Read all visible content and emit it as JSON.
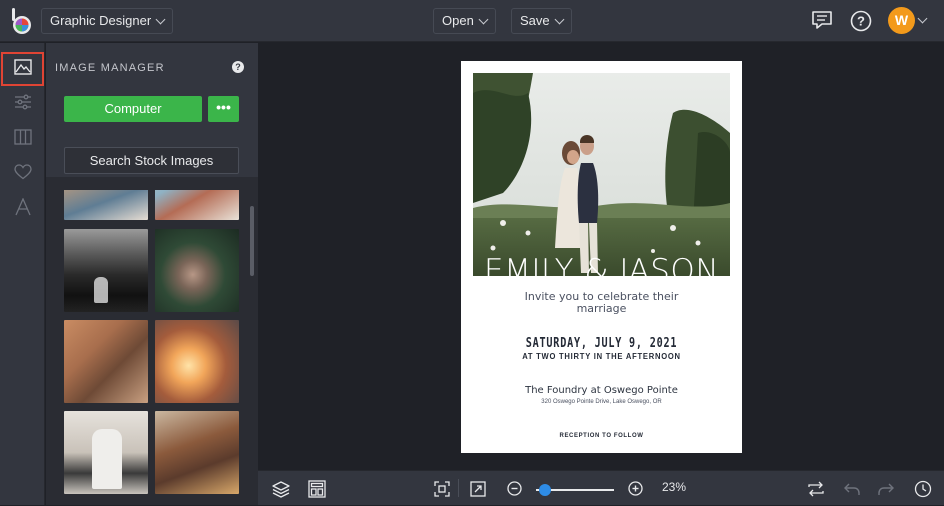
{
  "topbar": {
    "app_mode": "Graphic Designer",
    "open_label": "Open",
    "save_label": "Save",
    "avatar_initial": "W"
  },
  "sidebar": {
    "tools": [
      "image-manager",
      "adjust",
      "layout",
      "favorites",
      "text"
    ]
  },
  "panel": {
    "title": "IMAGE MANAGER",
    "computer_button": "Computer",
    "more_button": "•••",
    "search_stock_button": "Search Stock Images"
  },
  "invitation": {
    "names": "EMILY & JASON",
    "invite_line1": "Invite you to celebrate their",
    "invite_line2": "marriage",
    "date": "SATURDAY, JULY 9, 2021",
    "time": "AT TWO THIRTY IN THE AFTERNOON",
    "venue": "The Foundry at Oswego Pointe",
    "address": "320 Oswego Pointe Drive, Lake Oswego, OR",
    "reception": "RECEPTION TO FOLLOW"
  },
  "bottombar": {
    "zoom_value": "23%",
    "zoom_level": 0.12
  },
  "colors": {
    "accent_green": "#3bb54a",
    "highlight_red": "#e04434",
    "avatar_orange": "#f39a1b",
    "zoom_blue": "#2e8ce6"
  }
}
